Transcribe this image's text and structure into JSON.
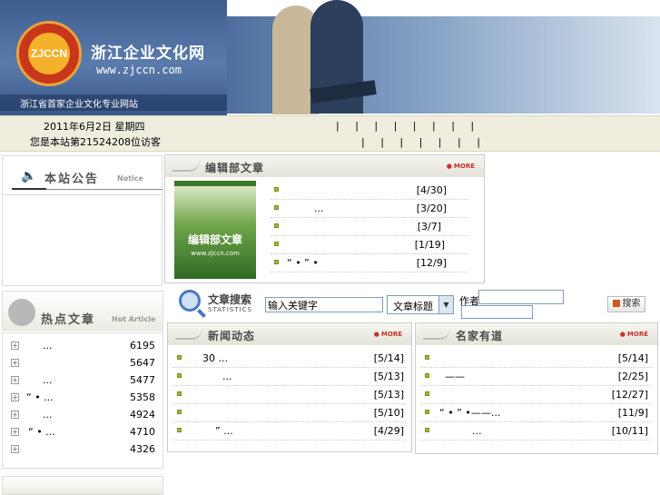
{
  "header": {
    "logo_text": "ZJCCN",
    "site_title": "浙江企业文化网",
    "site_url": "www.zjccn.com",
    "slogan": "浙江省首家企业文化专业网站"
  },
  "infobar": {
    "date": "2011年6月2日 星期四",
    "visitors": "您是本站第21524208位访客",
    "nav_row1": "| | | | | | | |",
    "nav_row2": "| | | | | | |"
  },
  "notice": {
    "title": "本站公告",
    "subtitle": "Notice"
  },
  "editorial": {
    "title": "编辑部文章",
    "more": "MORE",
    "thumb_text": "编辑部文章",
    "thumb_url": "www.zjccn.com",
    "items": [
      {
        "title": "",
        "date": "[4/30]"
      },
      {
        "title": "...",
        "date": "[3/20]"
      },
      {
        "title": "",
        "date": "[3/7]"
      },
      {
        "title": "",
        "date": "[1/19]"
      },
      {
        "title": "“ • ” •",
        "date": "[12/9]"
      }
    ]
  },
  "hot": {
    "title": "热点文章",
    "subtitle": "Hot Article",
    "items": [
      {
        "title": "...",
        "count": "6195"
      },
      {
        "title": "",
        "count": "5647"
      },
      {
        "title": "...",
        "count": "5477"
      },
      {
        "title": "“ • ...",
        "count": "5358"
      },
      {
        "title": "...",
        "count": "4924"
      },
      {
        "title": "“ • ...",
        "count": "4710"
      },
      {
        "title": "",
        "count": "4326"
      }
    ]
  },
  "search": {
    "title": "文章搜索",
    "subtitle": "STATISTICS",
    "prefix": "",
    "input_value": "输入关键字",
    "select_value": "文章标题",
    "label": "作者:",
    "button": "搜索"
  },
  "news": {
    "title": "新闻动态",
    "more": "MORE",
    "items": [
      {
        "title": "30 ...",
        "date": "[5/14]"
      },
      {
        "title": "...",
        "date": "[5/13]"
      },
      {
        "title": "",
        "date": "[5/13]"
      },
      {
        "title": "",
        "date": "[5/10]"
      },
      {
        "title": "” ...",
        "date": "[4/29]"
      }
    ]
  },
  "famous": {
    "title": "名家有道",
    "more": "MORE",
    "items": [
      {
        "title": "",
        "date": "[5/14]"
      },
      {
        "title": "——",
        "date": "[2/25]"
      },
      {
        "title": "",
        "date": "[12/27]"
      },
      {
        "title": "“ • ” •——...",
        "date": "[11/9]"
      },
      {
        "title": "...",
        "date": "[10/11]"
      }
    ]
  }
}
